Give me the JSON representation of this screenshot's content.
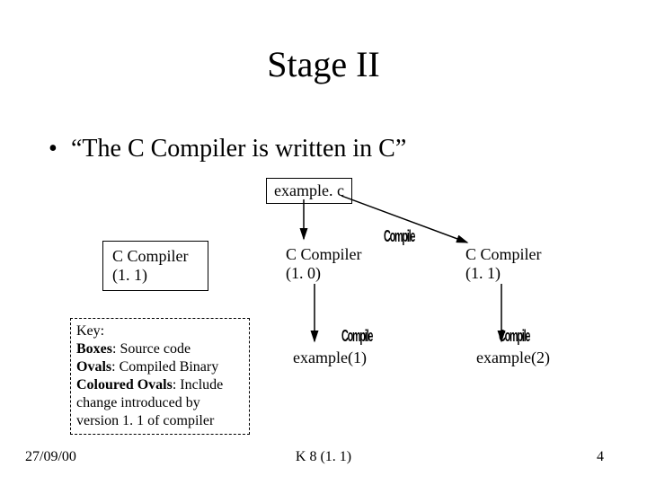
{
  "title": "Stage II",
  "bullet_text": "“The C Compiler is written in C”",
  "example_c": "example. c",
  "compiler_a": "C Compiler\n(1. 1)",
  "compiler_b": "C Compiler\n(1. 0)",
  "compiler_c": "C Compiler\n(1. 1)",
  "example1": "example(1)",
  "example2": "example(2)",
  "wordart_compile": "Compile",
  "key": {
    "h": "Key:",
    "l1": "Boxes: Source code",
    "l2": "Ovals: Compiled Binary",
    "l3a": "Coloured Ovals: Include",
    "l3b": "change introduced by",
    "l3c": "version 1. 1 of compiler"
  },
  "footer": {
    "date": "27/09/00",
    "center": "K 8 (1. 1)",
    "page": "4"
  }
}
